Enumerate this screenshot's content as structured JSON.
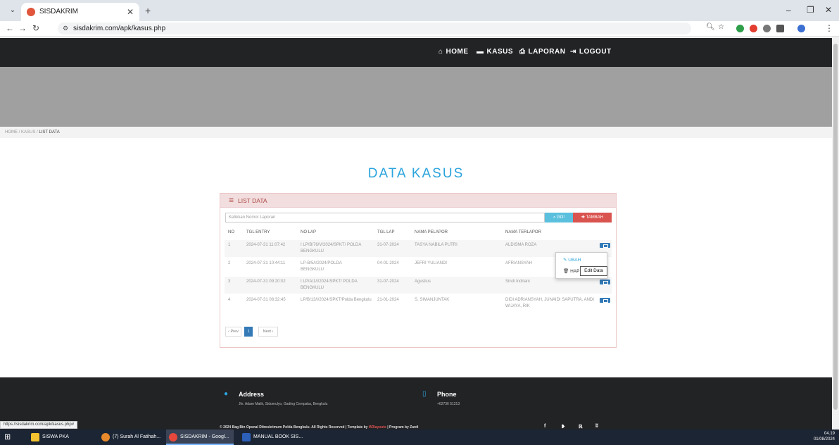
{
  "browser": {
    "tab_title": "SISDAKRIM",
    "url": "sisdakrim.com/apk/kasus.php",
    "status_url": "https://sisdakrim.com/apk/kasus.php#"
  },
  "nav": {
    "home": "HOME",
    "kasus": "KASUS",
    "laporan": "LAPORAN",
    "logout": "LOGOUT"
  },
  "breadcrumb": {
    "home": "HOME",
    "kasus": "KASUS",
    "current": "LIST DATA"
  },
  "page_title": "DATA KASUS",
  "panel": {
    "title": "LIST DATA",
    "search_placeholder": "Ketikkan Nomor Laporan",
    "go_label": "GO!",
    "add_label": "TAMBAH"
  },
  "table": {
    "headers": [
      "NO",
      "TGL ENTRY",
      "NO LAP",
      "TGL LAP",
      "NAMA PELAPOR",
      "NAMA TERLAPOR"
    ],
    "rows": [
      {
        "no": "1",
        "tgl_entry": "2024-07-31 11:07:42",
        "no_lap": "I LP/B/76/V/2024/SPKT/ POLDA BENGKULU",
        "tgl_lap": "31-07-2024",
        "pelapor": "TASYA NABILA PUTRI",
        "terlapor": "ALDISMA ROZA"
      },
      {
        "no": "2",
        "tgl_entry": "2024-07-31 10:44:11",
        "no_lap": "LP-B/5/I/2024/POLDA BENGKULU",
        "tgl_lap": "04-01-2024",
        "pelapor": "JEFRI YULIANDI",
        "terlapor": "AFRIANSYAH"
      },
      {
        "no": "3",
        "tgl_entry": "2024-07-31 09:20:02",
        "no_lap": "I LP/A/1/I/2024/SPKT/ POLDA BENGKULU",
        "tgl_lap": "31-07-2024",
        "pelapor": "Agustius",
        "terlapor": "Sindi Indriani"
      },
      {
        "no": "4",
        "tgl_entry": "2024-07-31 08:32:45",
        "no_lap": "LP/B/13/I/2024/SPKT/Polda Bengkulu",
        "tgl_lap": "21-01-2024",
        "pelapor": "S. SIMANJUNTAK",
        "terlapor": "DIDI ADRIANSYAH, JUNAIDI SAPUTRA, ANDI WIJAYA, RIK"
      }
    ]
  },
  "dropdown": {
    "edit_label": "UBAH",
    "delete_label": "HAP",
    "tooltip": "Edit Data"
  },
  "pagination": {
    "prev": "‹ Prev",
    "current": "1",
    "next": "Next ›"
  },
  "footer": {
    "address_title": "Address",
    "address_text": "Jln. Adam Malik, Sidomulyo, Gading Cempaka, Bengkulu",
    "phone_title": "Phone",
    "phone_text": "+62736 51213",
    "copyright": "© 2024 Bag Bin Opsnal Ditreskrimum Polda Bengkulu. All Rights Reserved | Template by",
    "template_by": "W3layouts",
    "program_by": "| Program by Zardi"
  },
  "taskbar": {
    "items": [
      "SISWA PKA",
      "(7) Surah Al Fatihah...",
      "SISDAKRIM - Googl...",
      "MANUAL BOOK SIS..."
    ],
    "time": "04.19",
    "date": "01/08/2024"
  },
  "colors": {
    "accent": "#2aa4dd",
    "navbar": "#222325",
    "danger": "#d9534f",
    "info": "#5bc0de",
    "primary": "#337ab7"
  }
}
